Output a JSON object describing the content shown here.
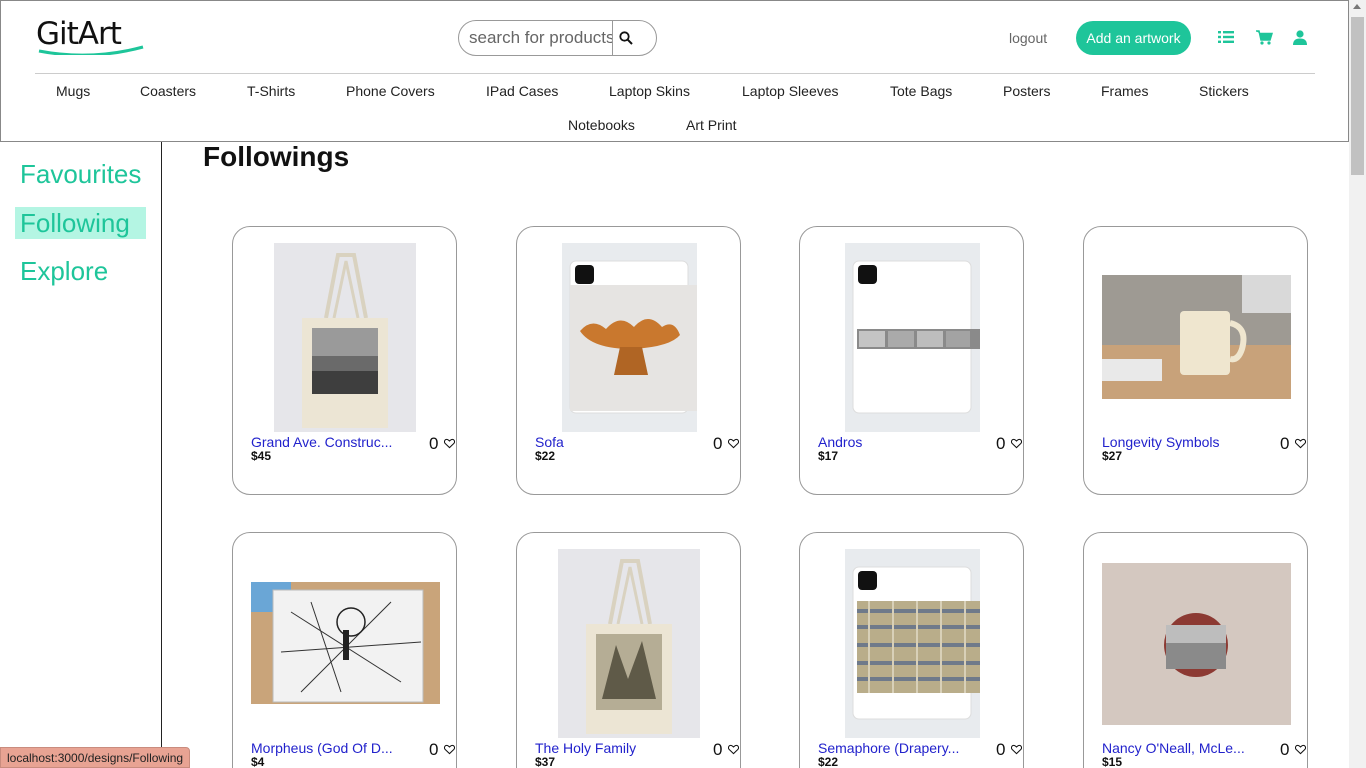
{
  "header": {
    "logo_text": "GitArt",
    "search_placeholder": "search for products",
    "logout_label": "logout",
    "add_artwork_label": "Add an artwork",
    "accent_color": "#1ec59a",
    "icons": [
      "list-icon",
      "cart-icon",
      "user-icon",
      "search-icon"
    ]
  },
  "categories": {
    "row1": [
      "Mugs",
      "Coasters",
      "T-Shirts",
      "Phone Covers",
      "IPad Cases",
      "Laptop Skins",
      "Laptop Sleeves",
      "Tote Bags",
      "Posters",
      "Frames",
      "Stickers"
    ],
    "row2": [
      "Notebooks",
      "Art Print"
    ]
  },
  "sidebar": {
    "items": [
      {
        "label": "Favourites",
        "active": false
      },
      {
        "label": "Following",
        "active": true
      },
      {
        "label": "Explore",
        "active": false
      }
    ]
  },
  "main": {
    "title": "Followings",
    "cards": [
      {
        "title": "Grand Ave. Construc...",
        "price": "$45",
        "likes": "0",
        "product": "tote-bag"
      },
      {
        "title": "Sofa",
        "price": "$22",
        "likes": "0",
        "product": "ipad-case"
      },
      {
        "title": "Andros",
        "price": "$17",
        "likes": "0",
        "product": "ipad-case"
      },
      {
        "title": "Longevity Symbols",
        "price": "$27",
        "likes": "0",
        "product": "mug"
      },
      {
        "title": "Morpheus (God Of D...",
        "price": "$4",
        "likes": "0",
        "product": "laptop-skin"
      },
      {
        "title": "The Holy Family",
        "price": "$37",
        "likes": "0",
        "product": "tote-bag"
      },
      {
        "title": "Semaphore (Drapery...",
        "price": "$22",
        "likes": "0",
        "product": "ipad-case"
      },
      {
        "title": "Nancy O'Neall, McLe...",
        "price": "$15",
        "likes": "0",
        "product": "coaster"
      }
    ]
  },
  "status_bar": {
    "url": "localhost:3000/designs/Following"
  }
}
